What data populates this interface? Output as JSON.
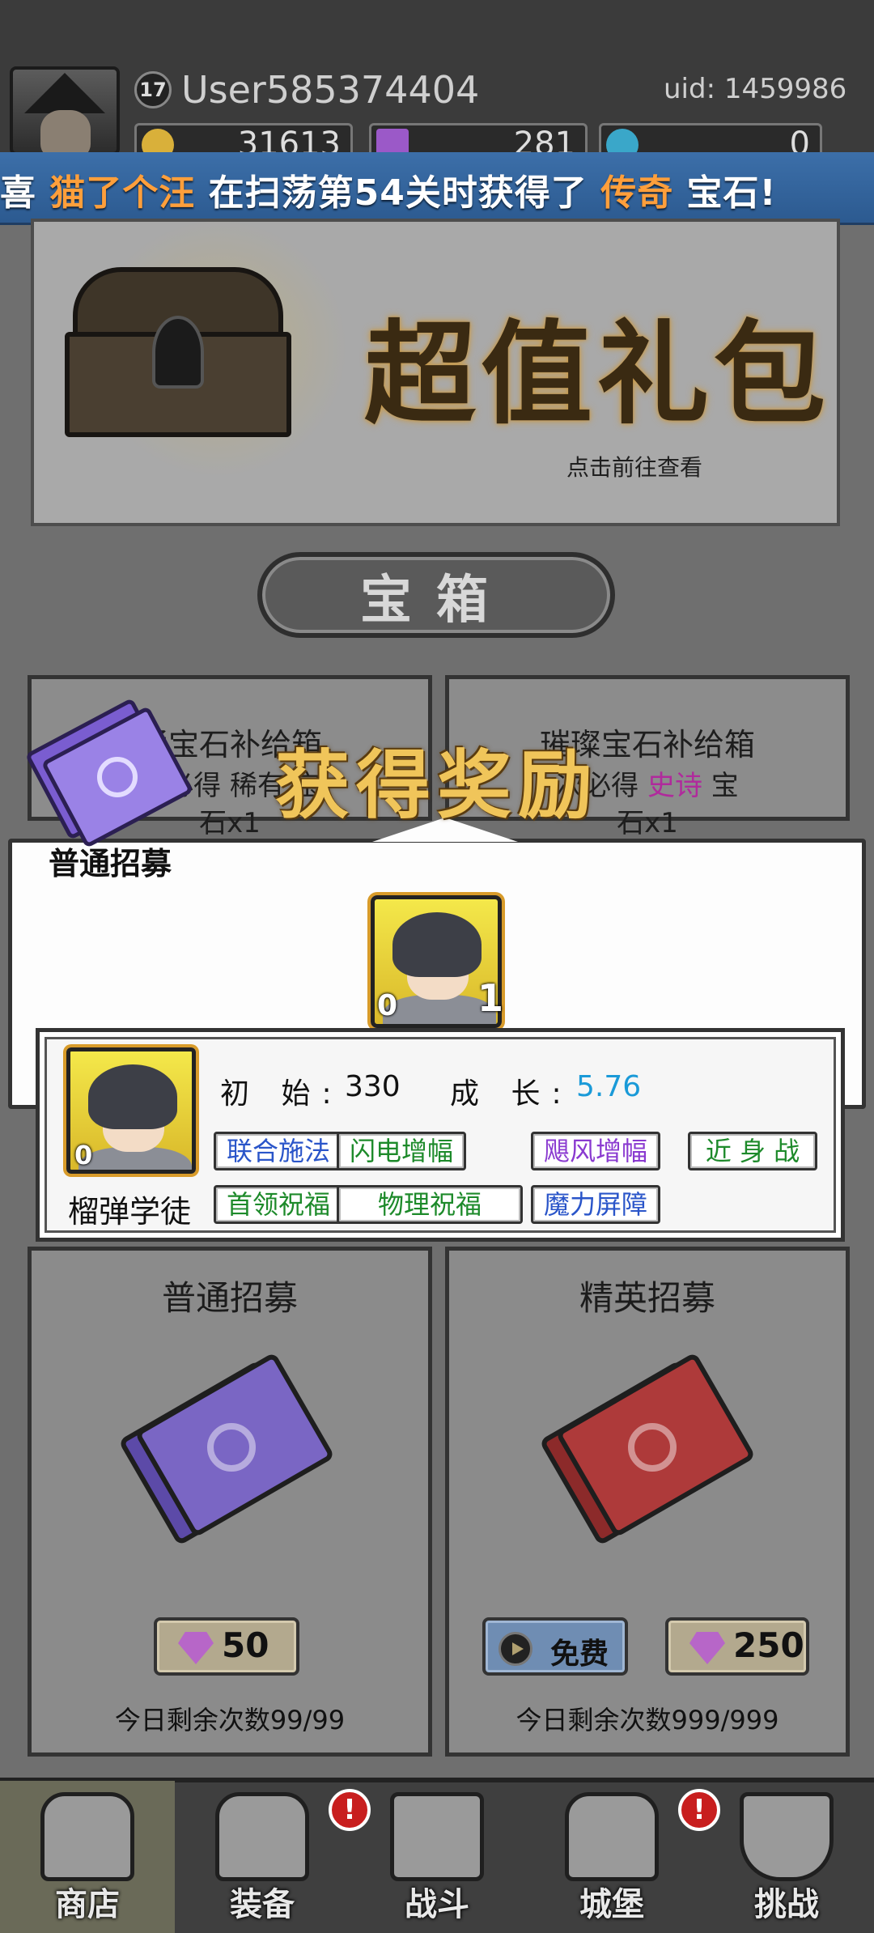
{
  "player": {
    "level": "17",
    "username": "User585374404",
    "uid": "uid: 1459986",
    "gold": "31613",
    "gems": "281",
    "third": "0"
  },
  "broadcast": {
    "prefix": "喜 ",
    "player": "猫了个汪",
    "middle": " 在扫荡第54关时获得了 ",
    "item": "传奇",
    "suffix": " 宝石!"
  },
  "gift_pack": {
    "title": "超值礼包",
    "hint": "点击前往查看"
  },
  "chest_section": {
    "header": "宝箱",
    "cards": [
      {
        "title": "通宝石补给箱",
        "sub": "次必得 稀有 宝",
        "sub2": "石x1"
      },
      {
        "title": "璀璨宝石补给箱",
        "sub_pre": "次必得 ",
        "sub_epic": "史诗",
        "sub_post": " 宝",
        "sub2": "石x1"
      }
    ]
  },
  "reward_popup": {
    "title": "获得奖励",
    "ticket_label": "普通招募",
    "hero_count_left": "0",
    "hero_count_right": "1"
  },
  "hero_detail": {
    "name": "榴弹学徒",
    "portrait_count": "0",
    "initial_label": "初 始:",
    "initial_value": "330",
    "growth_label": "成 长:",
    "growth_value": "5.76",
    "tags": [
      "联合施法",
      "闪电增幅",
      "飓风增幅",
      "近 身 战",
      "首领祝福",
      "物理祝福",
      "魔力屏障"
    ]
  },
  "recruit": {
    "normal": {
      "title": "普通招募",
      "price": "50",
      "remain": "今日剩余次数99/99"
    },
    "elite": {
      "title": "精英招募",
      "free": "免费",
      "price": "250",
      "remain": "今日剩余次数999/999"
    }
  },
  "bottom_nav": [
    {
      "label": "商店",
      "active": true
    },
    {
      "label": "装备",
      "badge": "!"
    },
    {
      "label": "战斗"
    },
    {
      "label": "城堡",
      "badge": "!"
    },
    {
      "label": "挑战"
    }
  ],
  "colors": {
    "broadcast_highlight": "#ff9f3b",
    "growth_value": "#1a9ad8",
    "epic": "#b02a9c",
    "reward_title": "#f0c55a"
  }
}
